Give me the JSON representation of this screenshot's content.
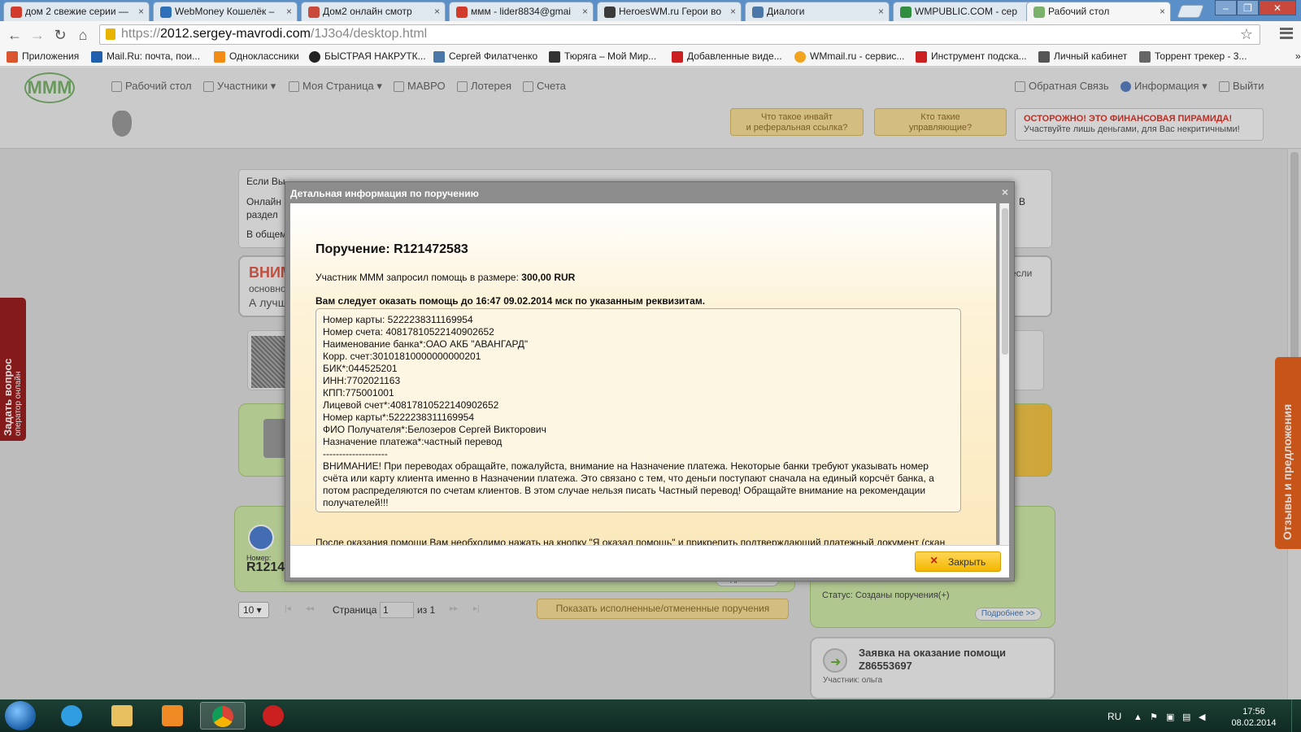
{
  "browser": {
    "tabs": [
      {
        "title": "дом 2 свежие серии —",
        "icon_color": "#d23b2b"
      },
      {
        "title": "WebMoney Кошелёк –",
        "icon_color": "#2d6fb8"
      },
      {
        "title": "Дом2 онлайн смотр",
        "icon_color": "#c94a3a"
      },
      {
        "title": "ммм - lider8834@gmai",
        "icon_color": "#d23b2b"
      },
      {
        "title": "HeroesWM.ru Герои во",
        "icon_color": "#3a3a3a"
      },
      {
        "title": "Диалоги",
        "icon_color": "#4a76a8"
      },
      {
        "title": "WMPUBLIC.COM - сер",
        "icon_color": "#2f8f3f"
      },
      {
        "title": "Рабочий стол",
        "icon_color": "#7ab26c"
      }
    ],
    "close_glyph": "×",
    "url_prefix": "https://",
    "url_host": "2012.sergey-mavrodi.com",
    "url_path": "/1J3o4/desktop.html",
    "bookmarks": [
      {
        "label": "Приложения",
        "icon_color": "#d9542f"
      },
      {
        "label": "Mail.Ru: почта, пои...",
        "icon_color": "#1f5fae"
      },
      {
        "label": "Одноклассники",
        "icon_color": "#f28c14"
      },
      {
        "label": "БЫСТРАЯ НАКРУТК...",
        "icon_color": "#222222"
      },
      {
        "label": "Сергей Филатченко",
        "icon_color": "#4a76a8"
      },
      {
        "label": "Тюряга – Мой Мир...",
        "icon_color": "#333333"
      },
      {
        "label": "Добавленные виде...",
        "icon_color": "#cc1f1f"
      },
      {
        "label": "WMmail.ru - сервис...",
        "icon_color": "#f2a41f"
      },
      {
        "label": "Инструмент подска...",
        "icon_color": "#cc1f1f"
      },
      {
        "label": "Личный кабинет",
        "icon_color": "#555555"
      },
      {
        "label": "Торрент трекер - 3...",
        "icon_color": "#666666"
      }
    ]
  },
  "site": {
    "logo_text": "MMM",
    "nav": [
      "Рабочий стол",
      "Участники ▾",
      "Моя Страница ▾",
      "МАВРО",
      "Лотерея",
      "Счета"
    ],
    "nav_right": [
      "Обратная Связь",
      "Информация ▾",
      "Выйти"
    ],
    "info_buttons": [
      "Что такое инвайт\nи реферальная ссылка?",
      "Кто такие\nуправляющие?"
    ],
    "warning_title": "ОСТОРОЖНО! ЭТО ФИНАНСОВАЯ ПИРАМИДА!",
    "warning_sub": "Участвуйте лишь деньгами, для Вас некритичными!"
  },
  "background": {
    "intro_lines": [
      "Если Вы ...",
      "Онлайн",
      "раздел",
      "В общем"
    ],
    "intro_right": "В",
    "attention_title": "ВНИМ",
    "attention_line2": "основно",
    "attention_line3": "А лучш",
    "attention_right": "если",
    "number_label": "Номер:",
    "number_value": "R1214",
    "more_btn": "Подробнее >>",
    "status_text": "Статус: Созданы поручения(+)",
    "per_page": "10 ▾",
    "page_label": "Страница",
    "page_value": "1",
    "page_of": "из 1",
    "show_done_btn": "Показать исполненные/отмененные поручения",
    "request_title": "Заявка на оказание помощи",
    "request_id": "Z86553697",
    "request_participant": "Участник: ольга"
  },
  "modal": {
    "header": "Детальная информация по поручению",
    "order_title": "Поручение: R121472583",
    "request_prefix": "Участник МММ запросил помощь в размере:",
    "request_amount": "300,00 RUR",
    "deadline": "Вам следует оказать помощь до 16:47 09.02.2014 мск по указанным реквизитам.",
    "details": [
      "Номер карты: 5222238311169954",
      "Номер счета: 40817810522140902652",
      "Наименование банка*:ОАО АКБ \"АВАНГАРД\"",
      "Корр. счет:30101810000000000201",
      "БИК*:044525201",
      "ИНН:7702021163",
      "КПП:775001001",
      "Лицевой счет*:40817810522140902652",
      "Номер карты*:5222238311169954",
      "ФИО Получателя*:Белозеров Сергей Викторович",
      "Назначение платежа*:частный перевод",
      "--------------------"
    ],
    "details_warning": "ВНИМАНИЕ! При переводах обращайте, пожалуйста, внимание на Назначение платежа. Некоторые банки требуют указывать номер счёта или карту клиента именно в Назначении платежа. Это связано с тем, что деньги поступают сначала на единый корсчёт банка, а потом распределяются по счетам клиентов. В этом случае нельзя писать Частный перевод! Обращайте внимание на рекомендации получателей!!!",
    "after_text": "После оказания помощи Вам необходимо нажать на кнопку \"Я оказал помощь\" и прикрепить подтверждающий платежный документ (скан чека или скриншот операции проведенной при помощи интернет-банка), в появившемся диалоговом окне.",
    "close_label": "Закрыть",
    "close_glyph": "×"
  },
  "widgets": {
    "ask_title": "Задать вопрос",
    "ask_sub": "оператор онлайн",
    "feedback": "Отзывы и предложения"
  },
  "taskbar": {
    "lang": "RU",
    "time": "17:56",
    "date": "08.02.2014"
  }
}
